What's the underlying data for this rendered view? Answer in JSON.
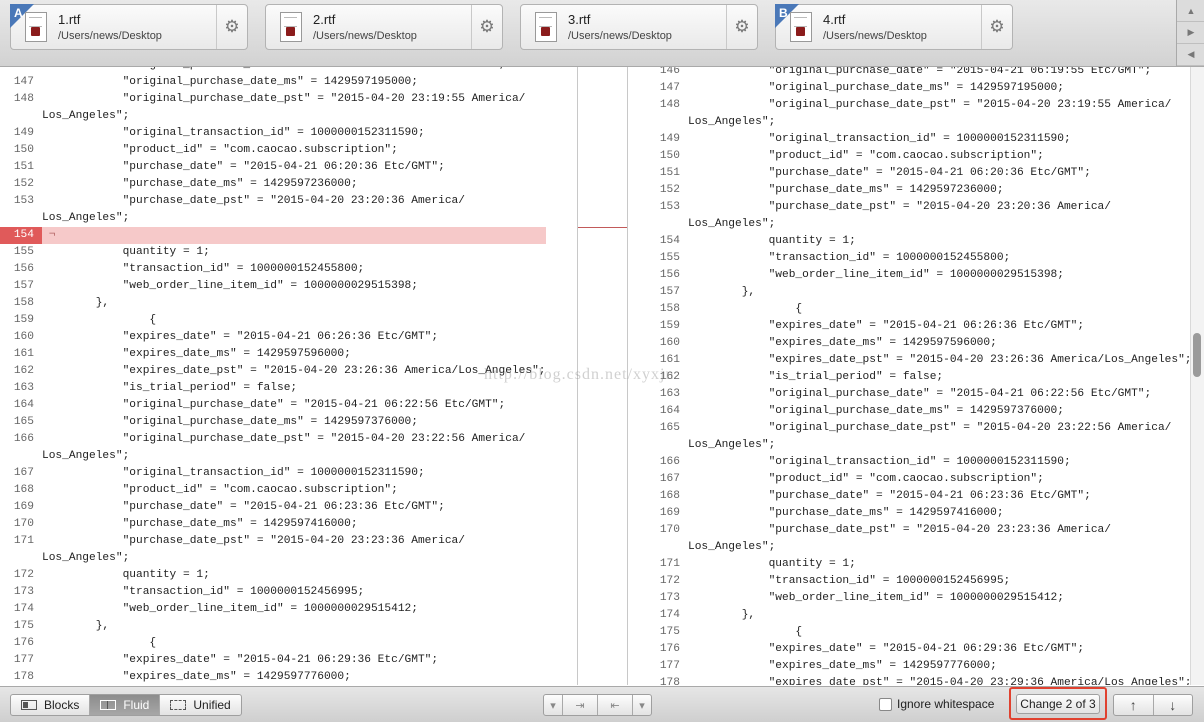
{
  "tabs": [
    {
      "letter": "A",
      "name": "1.rtf",
      "path": "/Users/news/Desktop",
      "icon": "rtf-document-icon"
    },
    {
      "letter": "",
      "name": "2.rtf",
      "path": "/Users/news/Desktop",
      "icon": "rtf-document-icon"
    },
    {
      "letter": "",
      "name": "3.rtf",
      "path": "/Users/news/Desktop",
      "icon": "rtf-document-icon"
    },
    {
      "letter": "B",
      "name": "4.rtf",
      "path": "/Users/news/Desktop",
      "icon": "rtf-document-icon"
    }
  ],
  "left_pane": {
    "lines": [
      {
        "num": "",
        "text": "            \"original_purchase_date\" = \"2015-04-21 06:19:55 Etc/GMT\";",
        "clipped": true
      },
      {
        "num": "147",
        "text": "            \"original_purchase_date_ms\" = 1429597195000;"
      },
      {
        "num": "148",
        "text": "            \"original_purchase_date_pst\" = \"2015-04-20 23:19:55 America/"
      },
      {
        "num": "",
        "text": "Los_Angeles\";"
      },
      {
        "num": "149",
        "text": "            \"original_transaction_id\" = 1000000152311590;"
      },
      {
        "num": "150",
        "text": "            \"product_id\" = \"com.caocao.subscription\";"
      },
      {
        "num": "151",
        "text": "            \"purchase_date\" = \"2015-04-21 06:20:36 Etc/GMT\";"
      },
      {
        "num": "152",
        "text": "            \"purchase_date_ms\" = 1429597236000;"
      },
      {
        "num": "153",
        "text": "            \"purchase_date_pst\" = \"2015-04-20 23:20:36 America/"
      },
      {
        "num": "",
        "text": "Los_Angeles\";"
      },
      {
        "num": "154",
        "text": " ¬",
        "changed": true
      },
      {
        "num": "155",
        "text": "            quantity = 1;"
      },
      {
        "num": "156",
        "text": "            \"transaction_id\" = 1000000152455800;"
      },
      {
        "num": "157",
        "text": "            \"web_order_line_item_id\" = 1000000029515398;"
      },
      {
        "num": "158",
        "text": "        },"
      },
      {
        "num": "159",
        "text": "                {"
      },
      {
        "num": "160",
        "text": "            \"expires_date\" = \"2015-04-21 06:26:36 Etc/GMT\";"
      },
      {
        "num": "161",
        "text": "            \"expires_date_ms\" = 1429597596000;"
      },
      {
        "num": "162",
        "text": "            \"expires_date_pst\" = \"2015-04-20 23:26:36 America/Los_Angeles\";"
      },
      {
        "num": "163",
        "text": "            \"is_trial_period\" = false;"
      },
      {
        "num": "164",
        "text": "            \"original_purchase_date\" = \"2015-04-21 06:22:56 Etc/GMT\";"
      },
      {
        "num": "165",
        "text": "            \"original_purchase_date_ms\" = 1429597376000;"
      },
      {
        "num": "166",
        "text": "            \"original_purchase_date_pst\" = \"2015-04-20 23:22:56 America/"
      },
      {
        "num": "",
        "text": "Los_Angeles\";"
      },
      {
        "num": "167",
        "text": "            \"original_transaction_id\" = 1000000152311590;"
      },
      {
        "num": "168",
        "text": "            \"product_id\" = \"com.caocao.subscription\";"
      },
      {
        "num": "169",
        "text": "            \"purchase_date\" = \"2015-04-21 06:23:36 Etc/GMT\";"
      },
      {
        "num": "170",
        "text": "            \"purchase_date_ms\" = 1429597416000;"
      },
      {
        "num": "171",
        "text": "            \"purchase_date_pst\" = \"2015-04-20 23:23:36 America/"
      },
      {
        "num": "",
        "text": "Los_Angeles\";"
      },
      {
        "num": "172",
        "text": "            quantity = 1;"
      },
      {
        "num": "173",
        "text": "            \"transaction_id\" = 1000000152456995;"
      },
      {
        "num": "174",
        "text": "            \"web_order_line_item_id\" = 1000000029515412;"
      },
      {
        "num": "175",
        "text": "        },"
      },
      {
        "num": "176",
        "text": "                {"
      },
      {
        "num": "177",
        "text": "            \"expires_date\" = \"2015-04-21 06:29:36 Etc/GMT\";"
      },
      {
        "num": "178",
        "text": "            \"expires_date_ms\" = 1429597776000;"
      },
      {
        "num": "179",
        "text": "            \"expires_date_pst\" = \"2015-04-20 23:29:36 America/Los_Angeles\";"
      }
    ]
  },
  "right_pane": {
    "lines": [
      {
        "num": "146",
        "text": "            \"original_purchase_date\" = \"2015-04-21 06:19:55 Etc/GMT\";"
      },
      {
        "num": "147",
        "text": "            \"original_purchase_date_ms\" = 1429597195000;"
      },
      {
        "num": "148",
        "text": "            \"original_purchase_date_pst\" = \"2015-04-20 23:19:55 America/"
      },
      {
        "num": "",
        "text": "Los_Angeles\";"
      },
      {
        "num": "149",
        "text": "            \"original_transaction_id\" = 1000000152311590;"
      },
      {
        "num": "150",
        "text": "            \"product_id\" = \"com.caocao.subscription\";"
      },
      {
        "num": "151",
        "text": "            \"purchase_date\" = \"2015-04-21 06:20:36 Etc/GMT\";"
      },
      {
        "num": "152",
        "text": "            \"purchase_date_ms\" = 1429597236000;"
      },
      {
        "num": "153",
        "text": "            \"purchase_date_pst\" = \"2015-04-20 23:20:36 America/"
      },
      {
        "num": "",
        "text": "Los_Angeles\";"
      },
      {
        "num": "154",
        "text": "            quantity = 1;"
      },
      {
        "num": "155",
        "text": "            \"transaction_id\" = 1000000152455800;"
      },
      {
        "num": "156",
        "text": "            \"web_order_line_item_id\" = 1000000029515398;"
      },
      {
        "num": "157",
        "text": "        },"
      },
      {
        "num": "158",
        "text": "                {"
      },
      {
        "num": "159",
        "text": "            \"expires_date\" = \"2015-04-21 06:26:36 Etc/GMT\";"
      },
      {
        "num": "160",
        "text": "            \"expires_date_ms\" = 1429597596000;"
      },
      {
        "num": "161",
        "text": "            \"expires_date_pst\" = \"2015-04-20 23:26:36 America/Los_Angeles\";"
      },
      {
        "num": "162",
        "text": "            \"is_trial_period\" = false;"
      },
      {
        "num": "163",
        "text": "            \"original_purchase_date\" = \"2015-04-21 06:22:56 Etc/GMT\";"
      },
      {
        "num": "164",
        "text": "            \"original_purchase_date_ms\" = 1429597376000;"
      },
      {
        "num": "165",
        "text": "            \"original_purchase_date_pst\" = \"2015-04-20 23:22:56 America/"
      },
      {
        "num": "",
        "text": "Los_Angeles\";"
      },
      {
        "num": "166",
        "text": "            \"original_transaction_id\" = 1000000152311590;"
      },
      {
        "num": "167",
        "text": "            \"product_id\" = \"com.caocao.subscription\";"
      },
      {
        "num": "168",
        "text": "            \"purchase_date\" = \"2015-04-21 06:23:36 Etc/GMT\";"
      },
      {
        "num": "169",
        "text": "            \"purchase_date_ms\" = 1429597416000;"
      },
      {
        "num": "170",
        "text": "            \"purchase_date_pst\" = \"2015-04-20 23:23:36 America/"
      },
      {
        "num": "",
        "text": "Los_Angeles\";"
      },
      {
        "num": "171",
        "text": "            quantity = 1;"
      },
      {
        "num": "172",
        "text": "            \"transaction_id\" = 1000000152456995;"
      },
      {
        "num": "173",
        "text": "            \"web_order_line_item_id\" = 1000000029515412;"
      },
      {
        "num": "174",
        "text": "        },"
      },
      {
        "num": "175",
        "text": "                {"
      },
      {
        "num": "176",
        "text": "            \"expires_date\" = \"2015-04-21 06:29:36 Etc/GMT\";"
      },
      {
        "num": "177",
        "text": "            \"expires_date_ms\" = 1429597776000;"
      },
      {
        "num": "178",
        "text": "            \"expires_date_pst\" = \"2015-04-20 23:29:36 America/Los_Angeles\";"
      }
    ]
  },
  "watermark": "http://blog.csdn.net/xyxjn",
  "bottom": {
    "modes": [
      {
        "label": "Blocks",
        "icon": "blocks-mode-icon",
        "active": false
      },
      {
        "label": "Fluid",
        "icon": "fluid-mode-icon",
        "active": true
      },
      {
        "label": "Unified",
        "icon": "unified-mode-icon",
        "active": false
      }
    ],
    "merge_arrows": [
      "▾",
      "⇥",
      "⇤",
      "▾"
    ],
    "ignore_whitespace_label": "Ignore whitespace",
    "ignore_whitespace_checked": false,
    "change_label": "Change 2 of 3",
    "prev_change": "↑",
    "next_change": "↓"
  },
  "colors": {
    "changed_line_bg": "#f6c9c9",
    "changed_number_bg": "#e05a5a",
    "highlight_outline": "#e0412f",
    "tab_letter_badge": "#4a78b8"
  }
}
